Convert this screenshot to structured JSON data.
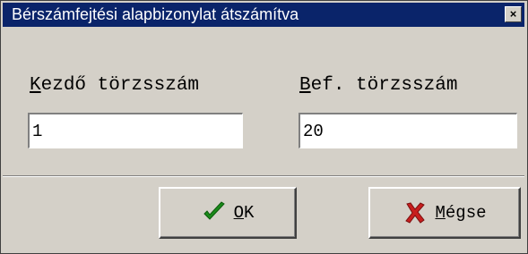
{
  "window": {
    "title": "Bérszámfejtési alapbizonylat átszámítva",
    "close_glyph": "×"
  },
  "form": {
    "start_label_accel": "K",
    "start_label_rest": "ezdő törzsszám",
    "start_value": "1",
    "end_label_accel": "B",
    "end_label_rest": "ef. törzsszám",
    "end_value": "20"
  },
  "buttons": {
    "ok_accel": "O",
    "ok_rest": "K",
    "ok_icon": "checkmark-icon",
    "cancel_accel": "M",
    "cancel_rest": "égse",
    "cancel_icon": "x-icon"
  },
  "colors": {
    "titlebar": "#0a246a",
    "face": "#d4d0c8",
    "check": "#1a8a1a",
    "cross": "#c81e1e"
  }
}
